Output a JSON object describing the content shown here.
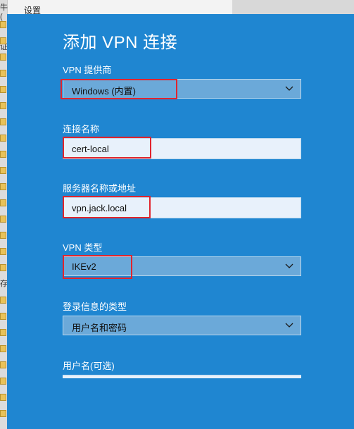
{
  "background": {
    "window_title": "设置",
    "side_glyphs": [
      "牛(",
      "证",
      "存"
    ]
  },
  "dialog": {
    "title": "添加 VPN 连接",
    "fields": {
      "vpn_provider": {
        "label": "VPN 提供商",
        "value": "Windows (内置)"
      },
      "connection_name": {
        "label": "连接名称",
        "value": "cert-local"
      },
      "server_address": {
        "label": "服务器名称或地址",
        "value": "vpn.jack.local"
      },
      "vpn_type": {
        "label": "VPN 类型",
        "value": "IKEv2"
      },
      "signin_type": {
        "label": "登录信息的类型",
        "value": "用户名和密码"
      },
      "username": {
        "label": "用户名(可选)",
        "value": ""
      }
    }
  },
  "colors": {
    "dialog_bg": "#1f86d1",
    "select_bg": "#6ba9d9",
    "input_bg": "#e8f1fb",
    "highlight": "#e1242d"
  },
  "icons": {
    "dropdown": "chevron-down-icon",
    "folder": "folder-icon"
  }
}
